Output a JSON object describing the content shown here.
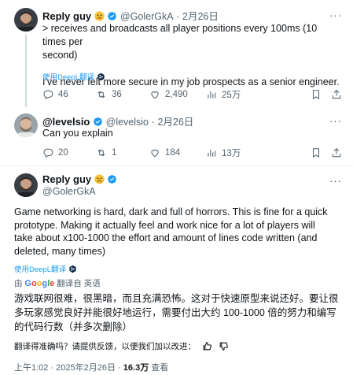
{
  "reply1": {
    "name": "Reply guy",
    "handle": "@GolerGkA",
    "date": "2月26日",
    "text_line1": "> receives and broadcasts all player positions every 100ms (10 times per",
    "text_line2": "second)",
    "text_line3": "I've never felt more secure in my job prospects as a senior engineer.",
    "translate_label": "使用DeepL翻译",
    "replies": "46",
    "retweets": "36",
    "likes": "2,490",
    "views": "25万"
  },
  "reply2": {
    "name": "@levelsio",
    "handle": "@levelsio",
    "date": "2月26日",
    "text": "Can you explain",
    "replies": "20",
    "retweets": "1",
    "likes": "184",
    "views": "13万"
  },
  "main": {
    "name": "Reply guy",
    "handle": "@GolerGkA",
    "body_line1": "Game networking is hard, dark and full of horrors. This is fine for a quick",
    "body_line2": "prototype. Making it actually feel and work nice for a lot of players will",
    "body_line3": "take about x100-1000 the effort and amount of lines code written (and",
    "body_line4": "deleted, many times)",
    "translate_label": "使用DeepL翻译",
    "translated_by_prefix": "由",
    "google_word": "Google",
    "translated_from": "翻译自 英语",
    "translation_line1": "游戏联网很难，很黑暗，而且充满恐怖。这对于快速原型来说还好。要让很",
    "translation_line2": "多玩家感觉良好并能很好地运行，需要付出大约 100-1000 倍的努力和编写",
    "translation_line3": "的代码行数（并多次删除）",
    "feedback_question": "翻译得准确吗？请提供反馈，以便我们加以改进：",
    "timestamp": "上午1:02 · 2025年2月26日 · ",
    "views_count": "16.3万",
    "views_label": " 查看"
  },
  "colors": {
    "accent": "#1d9bf0",
    "muted": "#536471",
    "text": "#0f1419",
    "border": "#eff3f4"
  },
  "icons": [
    "more-icon",
    "verified-icon",
    "reply-icon",
    "retweet-icon",
    "like-icon",
    "views-icon",
    "bookmark-icon",
    "share-icon",
    "thumbs-up-icon",
    "thumbs-down-icon"
  ]
}
